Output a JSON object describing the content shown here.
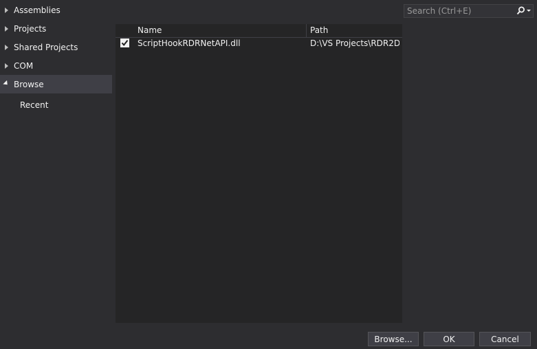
{
  "sidebar": {
    "items": [
      {
        "label": "Assemblies",
        "state": "collapsed"
      },
      {
        "label": "Projects",
        "state": "collapsed"
      },
      {
        "label": "Shared Projects",
        "state": "collapsed"
      },
      {
        "label": "COM",
        "state": "collapsed"
      },
      {
        "label": "Browse",
        "state": "expanded",
        "selected": true
      },
      {
        "label": "Recent",
        "state": "child"
      }
    ]
  },
  "table": {
    "columns": [
      "Name",
      "Path"
    ],
    "rows": [
      {
        "checked": true,
        "name": "ScriptHookRDRNetAPI.dll",
        "path": "D:\\VS Projects\\RDR2D..."
      }
    ]
  },
  "search": {
    "placeholder": "Search (Ctrl+E)",
    "icon": "search-icon"
  },
  "buttons": {
    "browse": "Browse...",
    "ok": "OK",
    "cancel": "Cancel"
  },
  "colors": {
    "background": "#2d2d30",
    "panel": "#252526",
    "selected": "#3f3f46",
    "text": "#f1f1f1"
  }
}
